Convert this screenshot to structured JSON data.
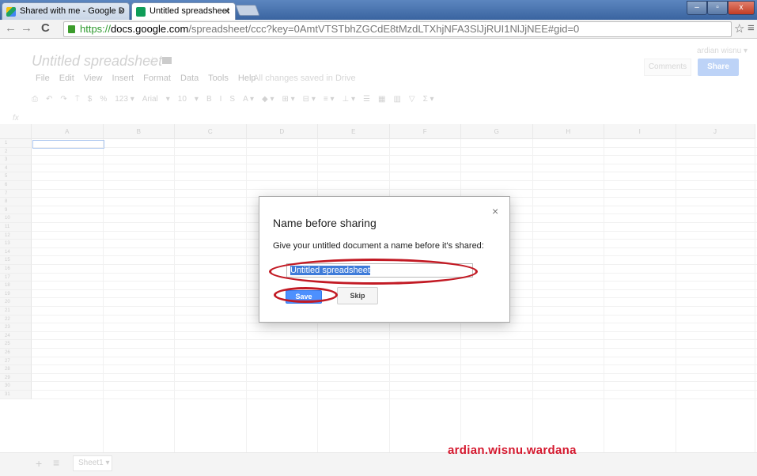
{
  "browser": {
    "tabs": [
      {
        "label": "Shared with me - Google D",
        "active": false
      },
      {
        "label": "Untitled spreadsheet",
        "active": true
      }
    ],
    "close_glyph": "×",
    "url_scheme": "https://",
    "url_host": "docs.google.com",
    "url_path": "/spreadsheet/ccc?key=0AmtVTSTbhZGCdE8tMzdLTXhjNFA3SlJjRUI1NlJjNEE#gid=0",
    "back_glyph": "←",
    "forward_glyph": "→",
    "reload_glyph": "C",
    "star_glyph": "☆",
    "menu_glyph": "≡"
  },
  "doc": {
    "title": "Untitled spreadsheet",
    "star_glyph": "☆",
    "menu": [
      "File",
      "Edit",
      "View",
      "Insert",
      "Format",
      "Data",
      "Tools",
      "Help"
    ],
    "saved_status": "All changes saved in Drive",
    "user": "ardian wisnu ▾",
    "comments_label": "Comments",
    "share_label": "Share",
    "format_toolbar": [
      "⎙",
      "↶",
      "↷",
      "⍑",
      "$",
      "%",
      "123 ▾",
      "Arial",
      "▾",
      "10",
      "▾",
      "B",
      "I",
      "S",
      "A ▾",
      "◆ ▾",
      "⊞ ▾",
      "⊟ ▾",
      "≡ ▾",
      "⊥ ▾",
      "☰",
      "▦",
      "▥",
      "▽",
      "Σ ▾"
    ],
    "fx_label": "fx"
  },
  "grid": {
    "columns": [
      "A",
      "B",
      "C",
      "D",
      "E",
      "F",
      "G",
      "H",
      "I",
      "J"
    ],
    "rows": [
      "1",
      "2",
      "3",
      "4",
      "5",
      "6",
      "7",
      "8",
      "9",
      "10",
      "11",
      "12",
      "13",
      "14",
      "15",
      "16",
      "17",
      "18",
      "19",
      "20",
      "21",
      "22",
      "23",
      "24",
      "25",
      "26",
      "27",
      "28",
      "29",
      "30",
      "31"
    ]
  },
  "sheets": {
    "add_glyph": "+",
    "list_glyph": "≡",
    "tabs": [
      "Sheet1 ▾"
    ]
  },
  "dialog": {
    "close_glyph": "×",
    "heading": "Name before sharing",
    "message": "Give your untitled document a name before it's shared:",
    "name_value": "Untitled spreadsheet",
    "save_label": "Save",
    "skip_label": "Skip"
  },
  "watermark": "ardian.wisnu.wardana",
  "colors": {
    "accent_blue": "#4d90fe",
    "annotation_red": "#c21a24"
  }
}
